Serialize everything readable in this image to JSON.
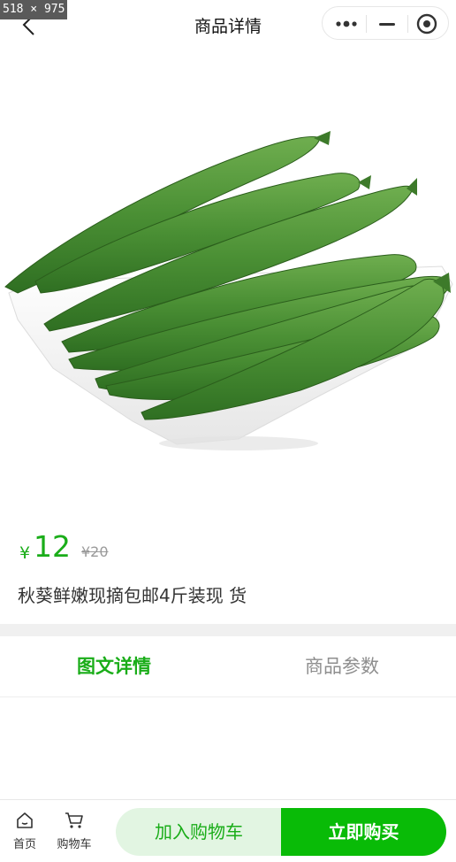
{
  "overlay": {
    "dimensions_label": "518 × 975"
  },
  "navbar": {
    "title": "商品详情",
    "icons": {
      "back": "back-icon",
      "more": "more-icon",
      "minimize": "minimize-icon",
      "close": "close-target-icon"
    }
  },
  "product": {
    "image": "okra-photo",
    "currency_symbol": "¥",
    "price": "12",
    "original_price": "¥20",
    "title": "秋葵鲜嫩现摘包邮4斤装现 货"
  },
  "tabs": [
    {
      "label": "图文详情",
      "active": true
    },
    {
      "label": "商品参数",
      "active": false
    }
  ],
  "bottom_bar": {
    "home_label": "首页",
    "cart_label": "购物车",
    "add_to_cart_label": "加入购物车",
    "buy_now_label": "立即购买"
  },
  "colors": {
    "accent": "#1aad19",
    "buy_button": "#09bb07",
    "add_cart_bg": "#e2f5e2",
    "muted_text": "#8e8e8e",
    "divider": "#f0f0f0"
  }
}
